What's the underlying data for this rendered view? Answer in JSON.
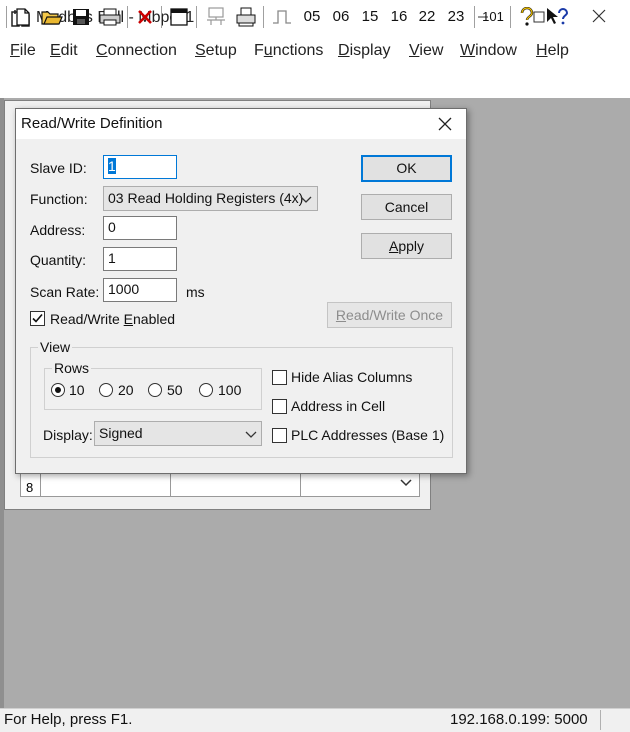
{
  "window": {
    "title": "Modbus Poll - Mbpoll1",
    "icon": "modbus-app-icon",
    "minimize": "—",
    "maximize": "☐",
    "close": "✕"
  },
  "menu": [
    {
      "pre": "",
      "ul": "F",
      "post": "ile"
    },
    {
      "pre": "",
      "ul": "E",
      "post": "dit"
    },
    {
      "pre": "",
      "ul": "C",
      "post": "onnection"
    },
    {
      "pre": "",
      "ul": "S",
      "post": "etup"
    },
    {
      "pre": "F",
      "ul": "u",
      "post": "nctions"
    },
    {
      "pre": "",
      "ul": "D",
      "post": "isplay"
    },
    {
      "pre": "",
      "ul": "V",
      "post": "iew"
    },
    {
      "pre": "",
      "ul": "W",
      "post": "indow"
    },
    {
      "pre": "",
      "ul": "H",
      "post": "elp"
    }
  ],
  "toolbar": {
    "new": "🗋",
    "open": "📂",
    "save": "💾",
    "print": "🖶",
    "delete": "✕",
    "window": "▭",
    "connect": "⎙",
    "print2": "⎚",
    "pulse": "⎍",
    "f05": "05",
    "f06": "06",
    "f15": "15",
    "f16": "16",
    "f22": "22",
    "f23": "23",
    "f101": "101",
    "help": "?",
    "context_help": "↖?"
  },
  "mdi": {
    "row_number": "8",
    "scroll_arrow": "⌄"
  },
  "dialog": {
    "title": "Read/Write Definition",
    "close": "✕",
    "slave_id": {
      "label": "Slave ID:",
      "value": "1"
    },
    "function": {
      "label": "Function:",
      "value": "03 Read Holding Registers (4x)"
    },
    "address": {
      "label": "Address:",
      "value": "0"
    },
    "quantity": {
      "label": "Quantity:",
      "value": "1"
    },
    "scan_rate": {
      "label": "Scan Rate:",
      "value": "1000",
      "unit": "ms"
    },
    "rw_enabled": {
      "pre": "Read/Write ",
      "ul": "E",
      "post": "nabled",
      "checked": true
    },
    "buttons": {
      "ok": "OK",
      "cancel": "Cancel",
      "apply_ul": "A",
      "apply_post": "pply",
      "rw_once_ul": "R",
      "rw_once_post": "ead/Write Once"
    },
    "view": {
      "title": "View",
      "rows_title": "Rows",
      "rows": [
        "10",
        "20",
        "50",
        "100"
      ],
      "rows_selected": "10",
      "hide_alias": "Hide Alias Columns",
      "address_in_cell": "Address in Cell",
      "plc_addresses": "PLC Addresses (Base 1)",
      "display_label": "Display:",
      "display_value": "Signed"
    }
  },
  "status": {
    "help": "For Help, press F1.",
    "connection": "192.168.0.199: 5000"
  }
}
